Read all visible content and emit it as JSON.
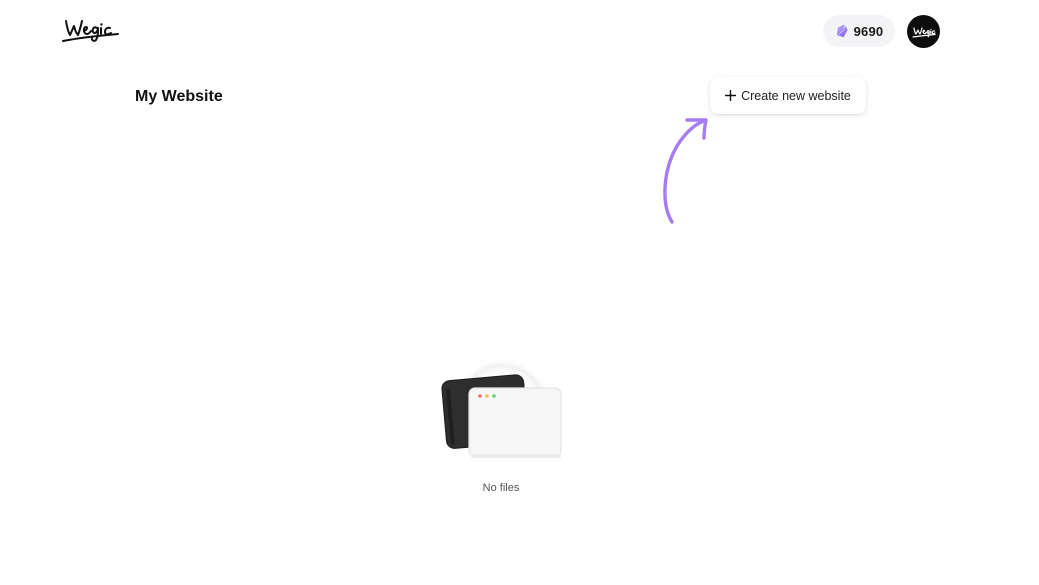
{
  "brand": {
    "logo_text": "wegic",
    "accent_color": "#a57cf2"
  },
  "header": {
    "credits": {
      "icon": "gem-icon",
      "count": "9690"
    },
    "avatar": {
      "icon": "wegic-avatar-icon"
    }
  },
  "main": {
    "title": "My Website",
    "create_button": {
      "icon": "plus-icon",
      "label": "Create new website"
    },
    "hint_arrow": {
      "icon": "curved-arrow-icon",
      "color": "#a57cf2"
    },
    "empty_state": {
      "icon": "browser-windows-icon",
      "text": "No files"
    }
  }
}
